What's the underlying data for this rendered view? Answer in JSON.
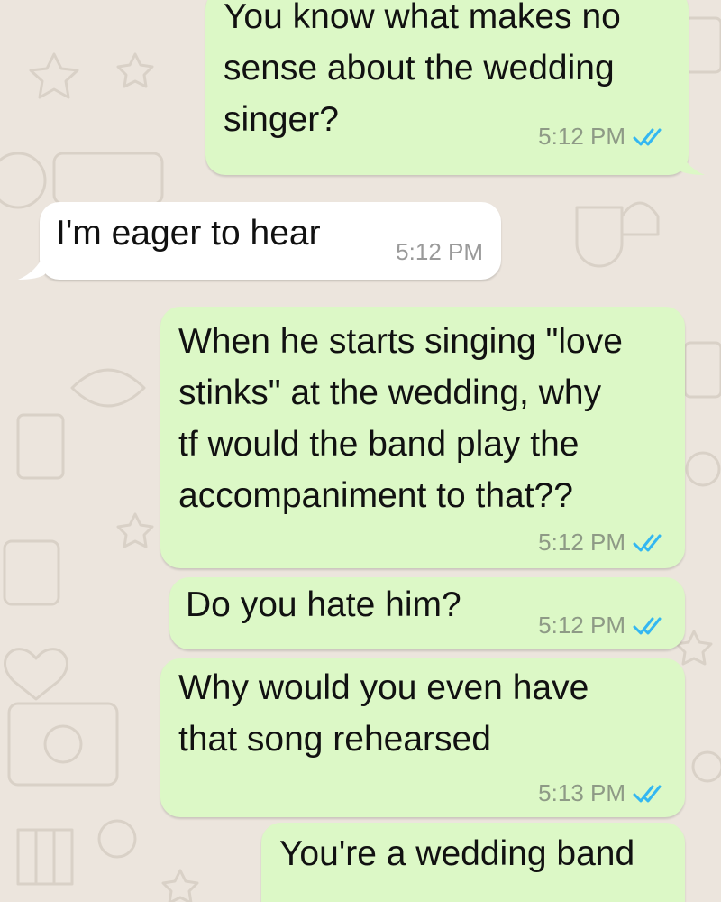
{
  "colors": {
    "outgoing_bubble": "#DCF8C6",
    "incoming_bubble": "#FFFFFF",
    "background": "#ECE5DD",
    "read_ticks": "#34B7F1",
    "timestamp": "#8E9A86"
  },
  "messages": [
    {
      "direction": "outgoing",
      "text": "You know what makes no\nsense about the wedding\nsinger?",
      "time": "5:12 PM",
      "status": "read"
    },
    {
      "direction": "incoming",
      "text": "I'm eager to hear",
      "time": "5:12 PM"
    },
    {
      "direction": "outgoing",
      "text": "When he starts singing \"love\nstinks\" at the wedding, why\ntf would the band play the\naccompaniment to that??",
      "time": "5:12 PM",
      "status": "read"
    },
    {
      "direction": "outgoing",
      "text": "Do you hate him?",
      "time": "5:12 PM",
      "status": "read"
    },
    {
      "direction": "outgoing",
      "text": "Why would you even have\nthat song rehearsed",
      "time": "5:13 PM",
      "status": "read"
    },
    {
      "direction": "outgoing",
      "text": "You're a wedding band",
      "time": "",
      "status": "read"
    }
  ]
}
